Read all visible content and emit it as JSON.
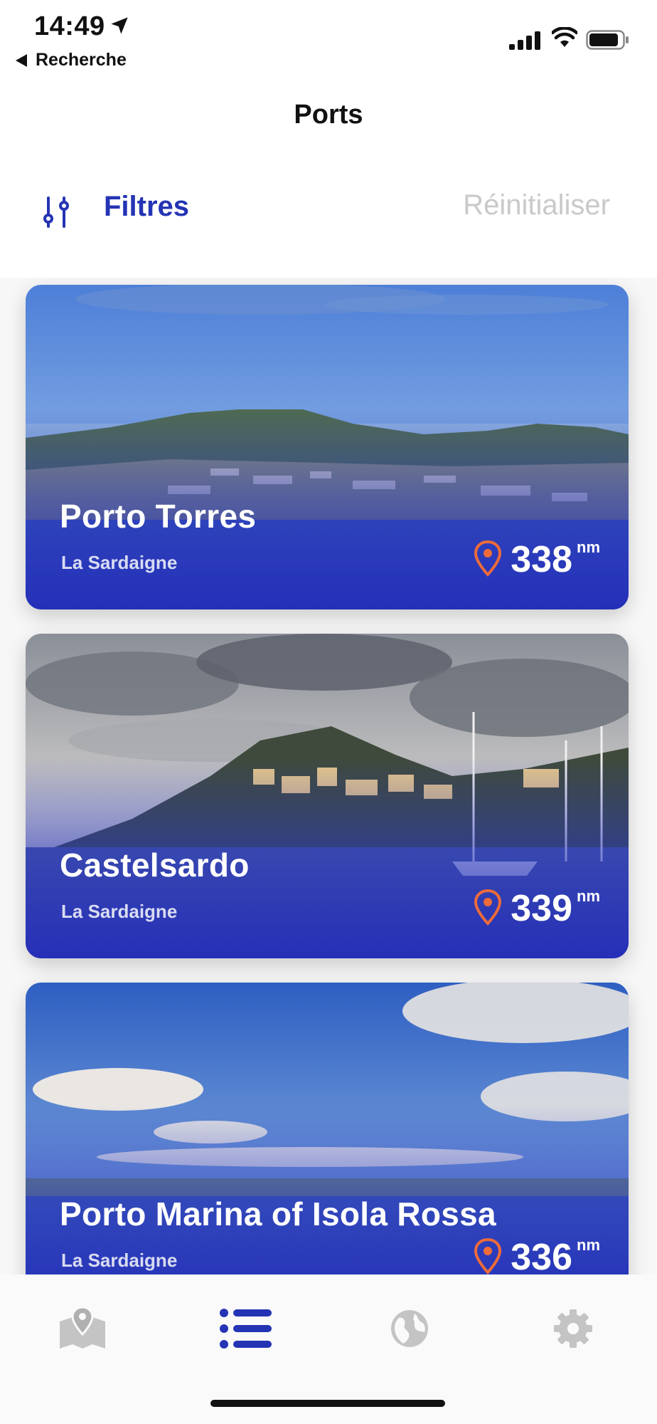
{
  "status": {
    "time": "14:49",
    "back": "Recherche"
  },
  "header": {
    "title": "Ports"
  },
  "filters": {
    "label": "Filtres",
    "reset": "Réinitialiser"
  },
  "ports": [
    {
      "name": "Porto Torres",
      "region": "La Sardaigne",
      "distance": "338",
      "unit": "nm"
    },
    {
      "name": "Castelsardo",
      "region": "La Sardaigne",
      "distance": "339",
      "unit": "nm"
    },
    {
      "name": "Porto Marina of Isola Rossa",
      "region": "La Sardaigne",
      "distance": "336",
      "unit": "nm"
    }
  ],
  "tabs": [
    {
      "icon": "map-icon",
      "active": false
    },
    {
      "icon": "list-icon",
      "active": true
    },
    {
      "icon": "globe-icon",
      "active": false
    },
    {
      "icon": "settings-icon",
      "active": false
    }
  ],
  "colors": {
    "accent": "#2434b4",
    "pin": "#ee6b3a",
    "inactive": "#c4c4c4",
    "reset": "#c9c9c9"
  }
}
